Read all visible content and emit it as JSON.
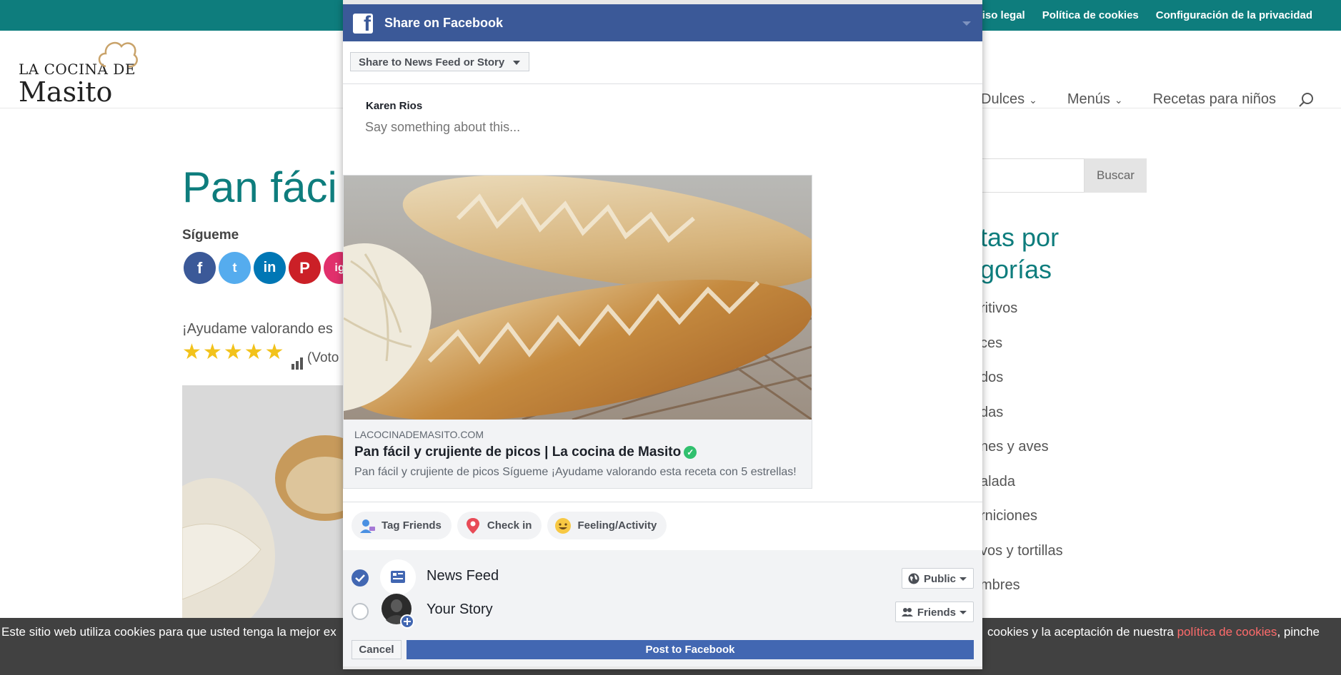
{
  "topbar": {
    "links": [
      "Aviso legal",
      "Política de cookies",
      "Configuración de la privacidad"
    ]
  },
  "logo": {
    "line1": "LA COCINA DE",
    "line2": "Masito"
  },
  "nav": {
    "items": [
      "Dulces",
      "Menús",
      "Recetas para niños"
    ]
  },
  "article": {
    "title_visible": "Pan fáci",
    "follow_label": "Sígueme",
    "socials": [
      "f",
      "t",
      "in",
      "P",
      "ig"
    ],
    "help_text": "¡Ayudame valorando es",
    "rating_stars": 5,
    "vote_label": "(Voto"
  },
  "sidebar": {
    "search_button": "Buscar",
    "title_line1": "tas por",
    "title_line2": "gorías",
    "categories": [
      "ritivos",
      "ces",
      "dos",
      "das",
      "nes y aves",
      "alada",
      "rniciones",
      "vos y tortillas",
      "mbres"
    ]
  },
  "cookie": {
    "left_text": "Este sitio web utiliza cookies para que usted tenga la mejor ex",
    "right_text": "cookies y la aceptación de nuestra ",
    "link_text": "política de cookies",
    "tail_text": ", pinche"
  },
  "facebook_dialog": {
    "header_title": "Share on Facebook",
    "destination": "Share to News Feed or Story",
    "user_name": "Karen Rios",
    "compose_placeholder": "Say something about this...",
    "card": {
      "domain": "LACOCINADEMASITO.COM",
      "title": "Pan fácil y crujiente de picos | La cocina de Masito",
      "description": "Pan fácil y crujiente de picos Sígueme ¡Ayudame valorando esta receta con 5 estrellas!"
    },
    "actions": [
      "Tag Friends",
      "Check in",
      "Feeling/Activity"
    ],
    "audience": [
      {
        "label": "News Feed",
        "privacy": "Public",
        "checked": true
      },
      {
        "label": "Your Story",
        "privacy": "Friends",
        "checked": false
      }
    ],
    "cancel_label": "Cancel",
    "post_label": "Post to Facebook"
  },
  "colors": {
    "brand_teal": "#0e7d7d",
    "facebook_blue": "#3b5998",
    "post_button": "#4267b2",
    "cookie_link": "#ff6b6b"
  }
}
